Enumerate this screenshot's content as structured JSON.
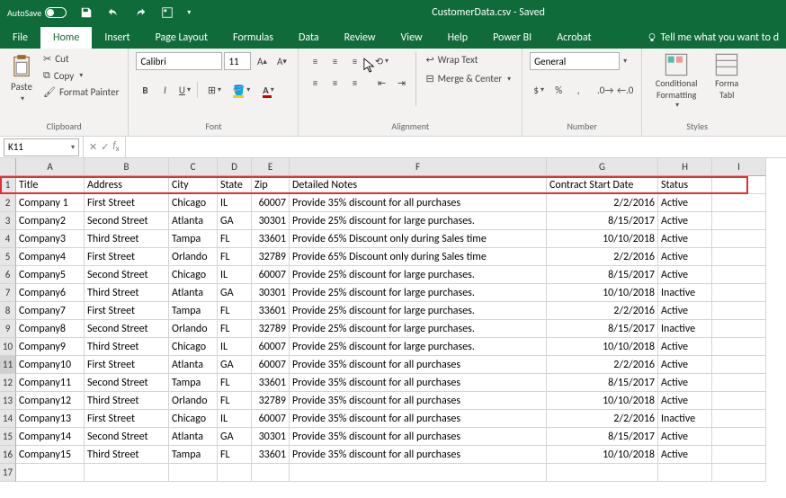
{
  "titlebar": {
    "autosave": "AutoSave",
    "title": "CustomerData.csv - Saved"
  },
  "ribbonTabs": [
    "File",
    "Home",
    "Insert",
    "Page Layout",
    "Formulas",
    "Data",
    "Review",
    "View",
    "Help",
    "Power BI",
    "Acrobat"
  ],
  "ribbonActive": "Home",
  "tellMe": "Tell me what you want to d",
  "clipboard": {
    "paste": "Paste",
    "cut": "Cut",
    "copy": "Copy",
    "formatPainter": "Format Painter",
    "label": "Clipboard"
  },
  "font": {
    "name": "Calibri",
    "size": "11",
    "label": "Font"
  },
  "alignment": {
    "wrap": "Wrap Text",
    "merge": "Merge & Center",
    "label": "Alignment"
  },
  "number": {
    "format": "General",
    "label": "Number"
  },
  "styles": {
    "conditional": "Conditional Formatting",
    "formatTable": "Forma Tabl",
    "label": "Styles"
  },
  "nameBox": "K11",
  "columns": [
    "A",
    "B",
    "C",
    "D",
    "E",
    "F",
    "G",
    "H",
    "I"
  ],
  "headerRow": [
    "Title",
    "Address",
    "City",
    "State",
    "Zip",
    "Detailed Notes",
    "Contract Start Date",
    "Status"
  ],
  "rows": [
    [
      "Company 1",
      "First Street",
      "Chicago",
      "IL",
      "60007",
      "Provide 35% discount for all purchases",
      "2/2/2016",
      "Active"
    ],
    [
      "Company2",
      "Second Street",
      "Atlanta",
      "GA",
      "30301",
      "Provide 25% discount for large purchases.",
      "8/15/2017",
      "Active"
    ],
    [
      "Company3",
      "Third Street",
      "Tampa",
      "FL",
      "33601",
      "Provide 65% Discount only during Sales time",
      "10/10/2018",
      "Active"
    ],
    [
      "Company4",
      "First Street",
      "Orlando",
      "FL",
      "32789",
      "Provide 65% Discount only during Sales time",
      "2/2/2016",
      "Active"
    ],
    [
      "Company5",
      "Second Street",
      "Chicago",
      "IL",
      "60007",
      "Provide 25% discount for large purchases.",
      "8/15/2017",
      "Active"
    ],
    [
      "Company6",
      "Third Street",
      "Atlanta",
      "GA",
      "30301",
      "Provide 25% discount for large purchases.",
      "10/10/2018",
      "Inactive"
    ],
    [
      "Company7",
      "First Street",
      "Tampa",
      "FL",
      "33601",
      "Provide 25% discount for large purchases.",
      "2/2/2016",
      "Active"
    ],
    [
      "Company8",
      "Second Street",
      "Orlando",
      "FL",
      "32789",
      "Provide 25% discount for large purchases.",
      "8/15/2017",
      "Inactive"
    ],
    [
      "Company9",
      "Third Street",
      "Chicago",
      "IL",
      "60007",
      "Provide 25% discount for large purchases.",
      "10/10/2018",
      "Active"
    ],
    [
      "Company10",
      "First Street",
      "Atlanta",
      "GA",
      "60007",
      "Provide 35% discount for all purchases",
      "2/2/2016",
      "Active"
    ],
    [
      "Company11",
      "Second Street",
      "Tampa",
      "FL",
      "33601",
      "Provide 35% discount for all purchases",
      "8/15/2017",
      "Active"
    ],
    [
      "Company12",
      "Third Street",
      "Orlando",
      "FL",
      "32789",
      "Provide 35% discount for all purchases",
      "10/10/2018",
      "Active"
    ],
    [
      "Company13",
      "First Street",
      "Chicago",
      "IL",
      "60007",
      "Provide 35% discount for all purchases",
      "2/2/2016",
      "Inactive"
    ],
    [
      "Company14",
      "Second Street",
      "Atlanta",
      "GA",
      "30301",
      "Provide 35% discount for all purchases",
      "8/15/2017",
      "Active"
    ],
    [
      "Company15",
      "Third Street",
      "Tampa",
      "FL",
      "33601",
      "Provide 35% discount for all purchases",
      "10/10/2018",
      "Active"
    ]
  ]
}
